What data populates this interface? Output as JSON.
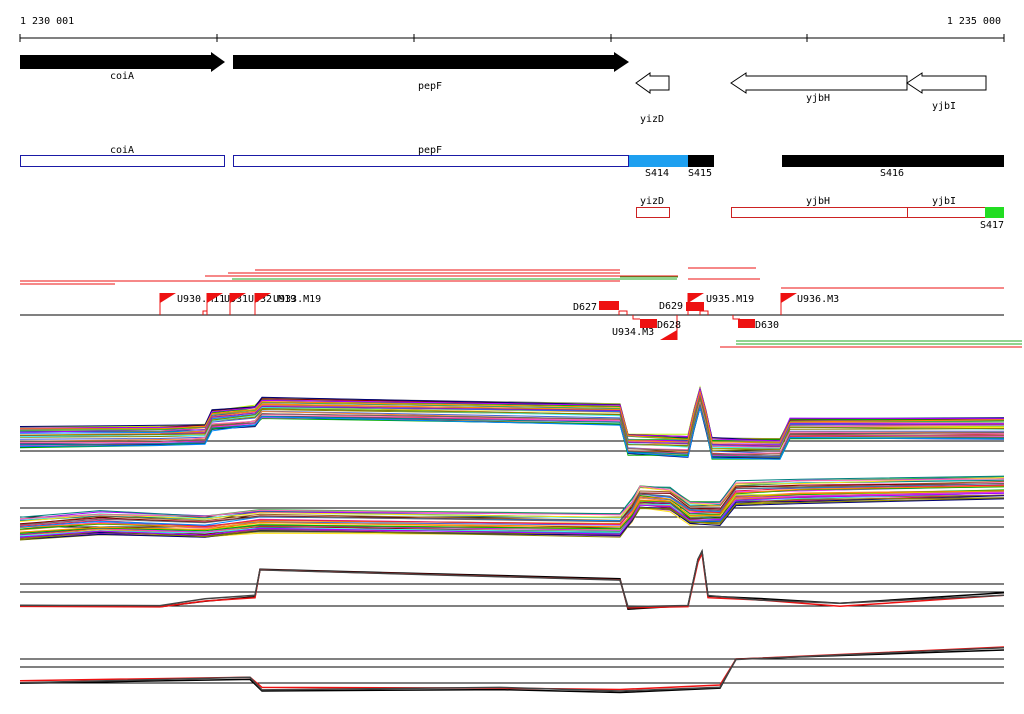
{
  "ruler": {
    "start_label": "1 230 001",
    "end_label": "1 235 000"
  },
  "colors": {
    "gene_fill": "#000000",
    "annotation_outline": "#1a1aa6",
    "segment_blue": "#1ea0f0",
    "segment_black": "#000000",
    "segment_green": "#22dd22",
    "operon_outline": "#cc2222",
    "tu_red": "#ee1111",
    "tu_green": "#22aa22",
    "profile_red": "#ee1111"
  },
  "genes": [
    {
      "label": "coiA",
      "strand": "forward",
      "filled": true
    },
    {
      "label": "pepF",
      "strand": "forward",
      "filled": true
    },
    {
      "label": "yizD",
      "strand": "reverse",
      "filled": false
    },
    {
      "label": "yjbH",
      "strand": "reverse",
      "filled": false
    },
    {
      "label": "yjbI",
      "strand": "reverse",
      "filled": false
    }
  ],
  "annotations": [
    {
      "label": "coiA"
    },
    {
      "label": "pepF"
    }
  ],
  "segments": [
    {
      "label": "S414",
      "color": "blue"
    },
    {
      "label": "S415",
      "color": "black"
    },
    {
      "label": "S416",
      "color": "black"
    },
    {
      "label": "S417",
      "color": "green"
    }
  ],
  "operons": [
    {
      "label": "yizD"
    },
    {
      "label": "yjbH"
    },
    {
      "label": "yjbI"
    }
  ],
  "upshifts": [
    {
      "label": "U930.M11"
    },
    {
      "label": "U931"
    },
    {
      "label": "U932.M19"
    },
    {
      "label": "U933.M19"
    },
    {
      "label": "U934.M3"
    },
    {
      "label": "U935.M19"
    },
    {
      "label": "U936.M3"
    }
  ],
  "downshifts": [
    {
      "label": "D627"
    },
    {
      "label": "D628"
    },
    {
      "label": "D629"
    },
    {
      "label": "D630"
    }
  ],
  "profile_panels": [
    {
      "kind": "multi-condition"
    },
    {
      "kind": "multi-condition"
    },
    {
      "kind": "summary"
    },
    {
      "kind": "summary"
    }
  ]
}
